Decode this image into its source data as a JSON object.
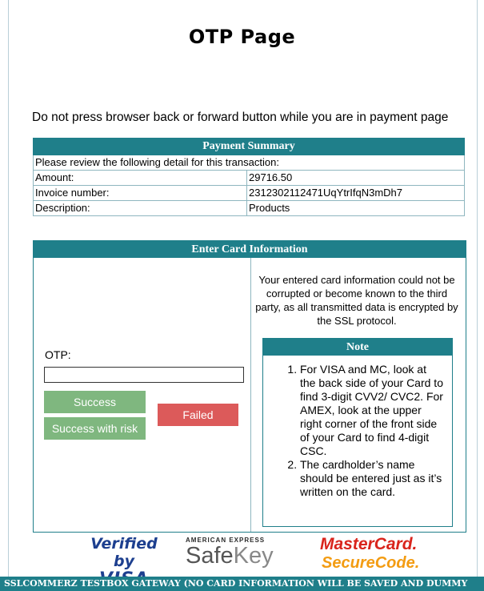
{
  "page": {
    "title": "OTP Page",
    "warning": "Do not press browser back or forward button while you are in payment page"
  },
  "summary": {
    "header": "Payment Summary",
    "intro": "Please review the following detail for this transaction:",
    "rows": [
      {
        "label": "Amount:",
        "value": "29716.50"
      },
      {
        "label": "Invoice number:",
        "value": "2312302112471UqYtrIfqN3mDh7"
      },
      {
        "label": "Description:",
        "value": "Products"
      }
    ]
  },
  "card": {
    "header": "Enter Card Information",
    "otp_label": "OTP:",
    "otp_value": "",
    "success_label": "Success",
    "risk_label": "Success with risk",
    "failed_label": "Failed",
    "info": "Your entered card information could not be corrupted or become known to the third party, as all transmitted data is encrypted by the SSL protocol.",
    "note_header": "Note",
    "notes": [
      "For VISA and MC, look at the back side of your Card to find 3-digit CVV2/ CVC2. For AMEX, look at the upper right corner of the front side of your Card to find 4-digit CSC.",
      "The cardholder’s name should be entered just as it’s written on the card."
    ]
  },
  "logos": {
    "visa_line1": "Verified by",
    "visa_line2": "VISA",
    "amex_line1": "AMERICAN EXPRESS",
    "amex_safe": "Safe",
    "amex_key": "Key",
    "mc_line1": "MasterCard.",
    "mc_line2": "SecureCode."
  },
  "footer": {
    "text": "SSLCOMMERZ TESTBOX GATEWAY (NO CARD INFORMATION WILL BE SAVED AND DUMMY"
  },
  "colors": {
    "accent": "#1f7f8a",
    "success": "#7fb77f",
    "failed": "#dc5a5a"
  }
}
